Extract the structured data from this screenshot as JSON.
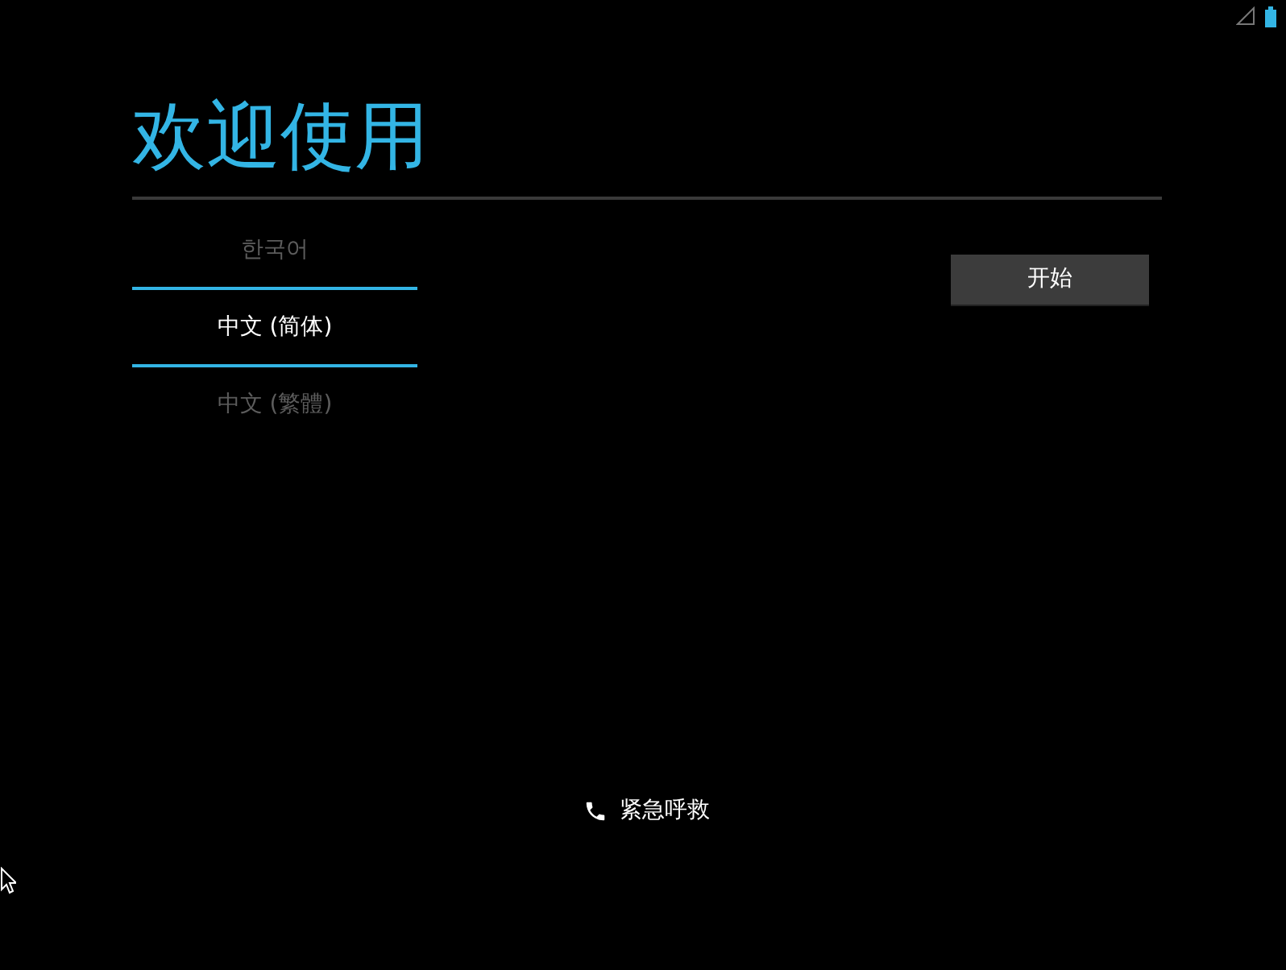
{
  "title": "欢迎使用",
  "languages": [
    {
      "label": "한국어",
      "selected": false
    },
    {
      "label": "中文 (简体)",
      "selected": true
    },
    {
      "label": "中文 (繁體)",
      "selected": false
    }
  ],
  "start_button": "开始",
  "emergency_call": "紧急呼救"
}
